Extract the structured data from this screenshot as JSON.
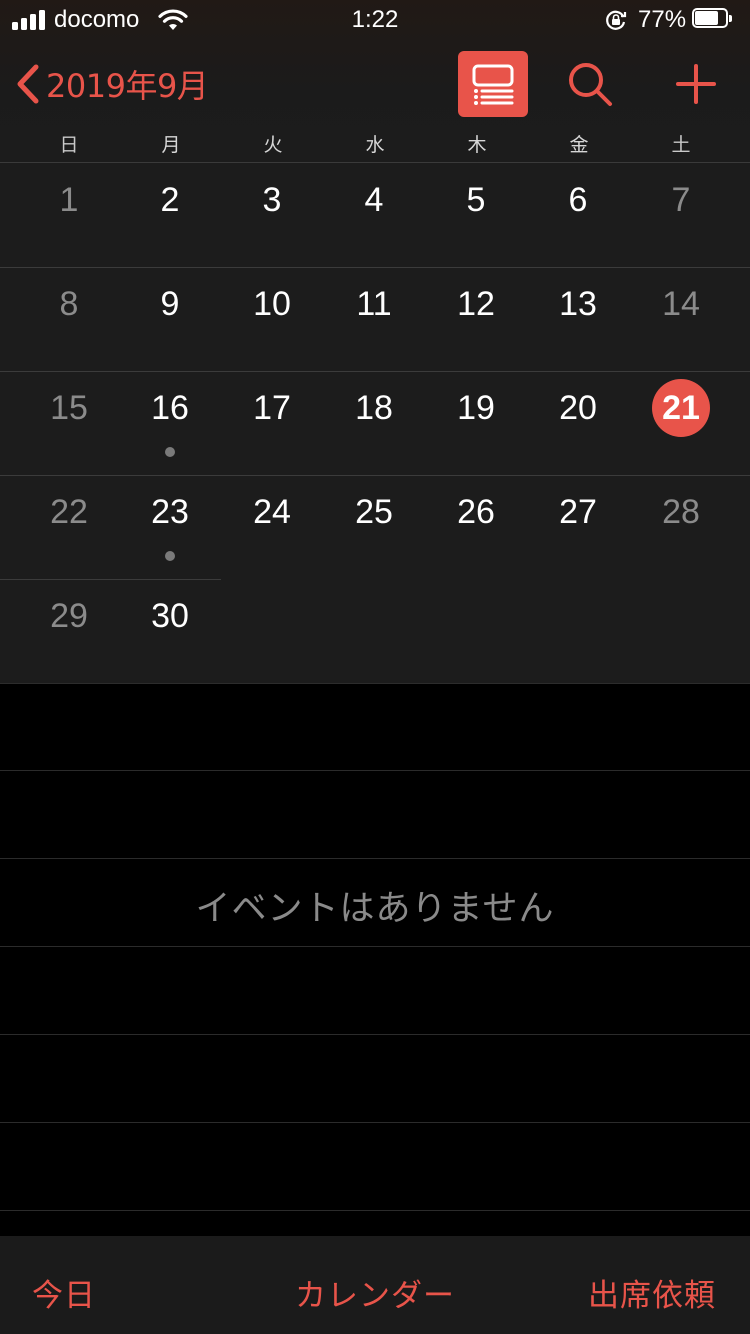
{
  "status_bar": {
    "carrier": "docomo",
    "time": "1:22",
    "battery_percent": "77%",
    "battery_level": 0.77,
    "icons": [
      "signal-icon",
      "wifi-icon",
      "rotation-lock-icon",
      "battery-icon"
    ]
  },
  "nav": {
    "back_label": "2019年9月",
    "icons": {
      "back": "chevron-left-icon",
      "list_toggle": "list-view-icon",
      "search": "search-icon",
      "add": "plus-icon"
    }
  },
  "weekdays": [
    "日",
    "月",
    "火",
    "水",
    "木",
    "金",
    "土"
  ],
  "weeks": [
    [
      {
        "day": "1"
      },
      {
        "day": "2"
      },
      {
        "day": "3"
      },
      {
        "day": "4"
      },
      {
        "day": "5"
      },
      {
        "day": "6"
      },
      {
        "day": "7"
      }
    ],
    [
      {
        "day": "8"
      },
      {
        "day": "9"
      },
      {
        "day": "10"
      },
      {
        "day": "11"
      },
      {
        "day": "12"
      },
      {
        "day": "13"
      },
      {
        "day": "14"
      }
    ],
    [
      {
        "day": "15"
      },
      {
        "day": "16",
        "has_event": true
      },
      {
        "day": "17"
      },
      {
        "day": "18"
      },
      {
        "day": "19"
      },
      {
        "day": "20"
      },
      {
        "day": "21",
        "today": true
      }
    ],
    [
      {
        "day": "22"
      },
      {
        "day": "23",
        "has_event": true
      },
      {
        "day": "24"
      },
      {
        "day": "25"
      },
      {
        "day": "26"
      },
      {
        "day": "27"
      },
      {
        "day": "28"
      }
    ],
    [
      {
        "day": "29"
      },
      {
        "day": "30"
      }
    ]
  ],
  "events": {
    "empty_message": "イベントはありません"
  },
  "tab_bar": {
    "today": "今日",
    "calendars": "カレンダー",
    "inbox": "出席依頼"
  },
  "colors": {
    "accent": "#e8544a",
    "weekend_text": "#8b8b8b",
    "weekday_text": "#ffffff",
    "event_dot": "#7a7a7a"
  }
}
